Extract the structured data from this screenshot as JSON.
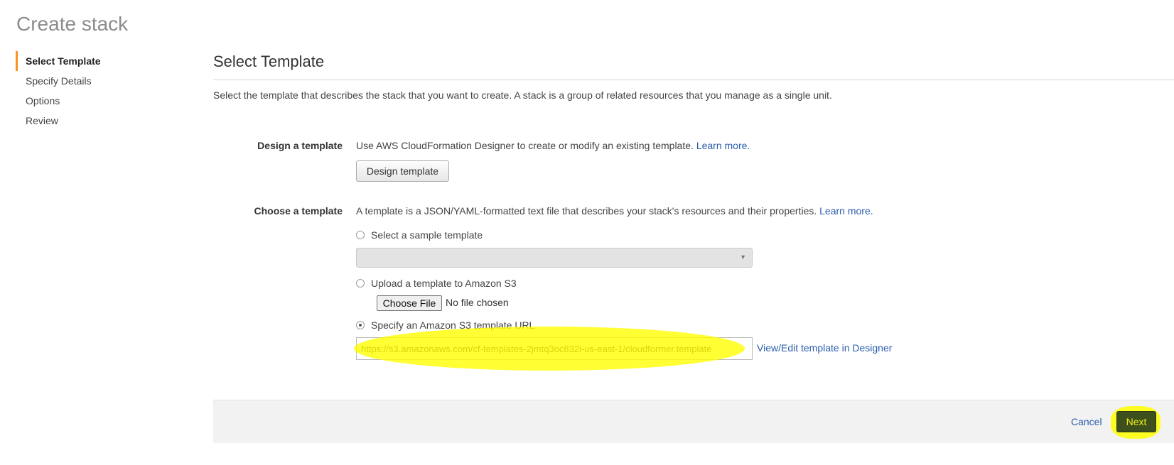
{
  "page": {
    "title": "Create stack"
  },
  "steps": [
    {
      "label": "Select Template",
      "active": true
    },
    {
      "label": "Specify Details"
    },
    {
      "label": "Options"
    },
    {
      "label": "Review"
    }
  ],
  "section": {
    "title": "Select Template",
    "intro": "Select the template that describes the stack that you want to create. A stack is a group of related resources that you manage as a single unit."
  },
  "design": {
    "label": "Design a template",
    "description": "Use AWS CloudFormation Designer to create or modify an existing template.",
    "learn_more": "Learn more.",
    "button": "Design template"
  },
  "choose": {
    "label": "Choose a template",
    "description": "A template is a JSON/YAML-formatted text file that describes your stack's resources and their properties.",
    "learn_more": "Learn more.",
    "options": {
      "sample": "Select a sample template",
      "upload": "Upload a template to Amazon S3",
      "url": "Specify an Amazon S3 template URL"
    },
    "selected": "url",
    "sample_select_value": "",
    "file_button": "Choose File",
    "file_status": "No file chosen",
    "url_value": "https://s3.amazonaws.com/cf-templates-2jmtq3oc832i-us-east-1/cloudformer.template",
    "view_edit_link": "View/Edit template in Designer"
  },
  "footer": {
    "cancel": "Cancel",
    "next": "Next"
  },
  "colors": {
    "accent_step": "#f7931e",
    "link": "#2a5dad",
    "next_button_bg": "#3c4f1c",
    "highlight": "#ffff00"
  }
}
